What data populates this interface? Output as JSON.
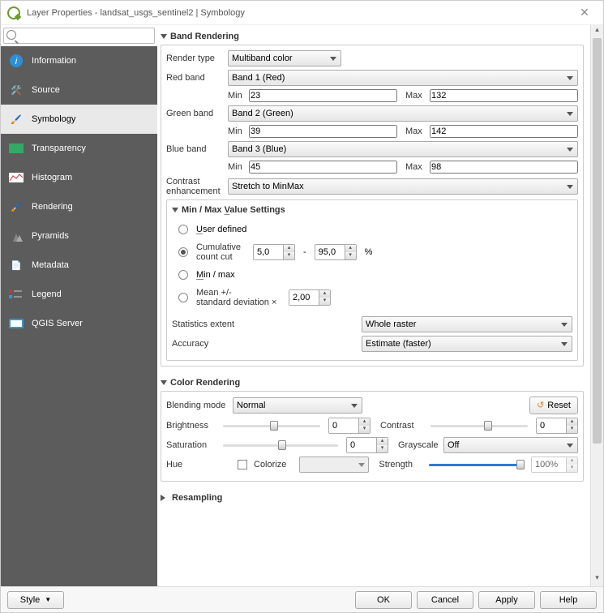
{
  "title": "Layer Properties - landsat_usgs_sentinel2 | Symbology",
  "sidebar": {
    "items": [
      {
        "label": "Information"
      },
      {
        "label": "Source"
      },
      {
        "label": "Symbology"
      },
      {
        "label": "Transparency"
      },
      {
        "label": "Histogram"
      },
      {
        "label": "Rendering"
      },
      {
        "label": "Pyramids"
      },
      {
        "label": "Metadata"
      },
      {
        "label": "Legend"
      },
      {
        "label": "QGIS Server"
      }
    ],
    "active": 2
  },
  "band_rendering": {
    "heading": "Band Rendering",
    "render_type_label": "Render type",
    "render_type": "Multiband color",
    "red_label": "Red band",
    "red_band": "Band 1 (Red)",
    "red_min": "23",
    "red_max": "132",
    "green_label": "Green band",
    "green_band": "Band 2 (Green)",
    "green_min": "39",
    "green_max": "142",
    "blue_label": "Blue band",
    "blue_band": "Band 3 (Blue)",
    "blue_min": "45",
    "blue_max": "98",
    "min_label": "Min",
    "max_label": "Max",
    "contrast_label": "Contrast\nenhancement",
    "contrast": "Stretch to MinMax"
  },
  "minmax": {
    "heading": "Min / Max Value Settings",
    "user_defined": "User defined",
    "cum_label": "Cumulative\ncount cut",
    "cum_low": "5,0",
    "cum_sep": "-",
    "cum_high": "95,0",
    "cum_pct": "%",
    "minmax_label": "Min / max",
    "mean_label": "Mean +/-\nstandard deviation ×",
    "mean_val": "2,00",
    "stats_label": "Statistics extent",
    "stats_val": "Whole raster",
    "acc_label": "Accuracy",
    "acc_val": "Estimate (faster)",
    "selected": "cumulative"
  },
  "color_rendering": {
    "heading": "Color Rendering",
    "blend_label": "Blending mode",
    "blend_val": "Normal",
    "reset": "Reset",
    "brightness": "Brightness",
    "brightness_val": "0",
    "contrast": "Contrast",
    "contrast_val": "0",
    "saturation": "Saturation",
    "saturation_val": "0",
    "grayscale": "Grayscale",
    "grayscale_val": "Off",
    "hue": "Hue",
    "colorize": "Colorize",
    "strength": "Strength",
    "strength_val": "100%"
  },
  "resampling": {
    "heading": "Resampling"
  },
  "footer": {
    "style": "Style",
    "ok": "OK",
    "cancel": "Cancel",
    "apply": "Apply",
    "help": "Help"
  }
}
